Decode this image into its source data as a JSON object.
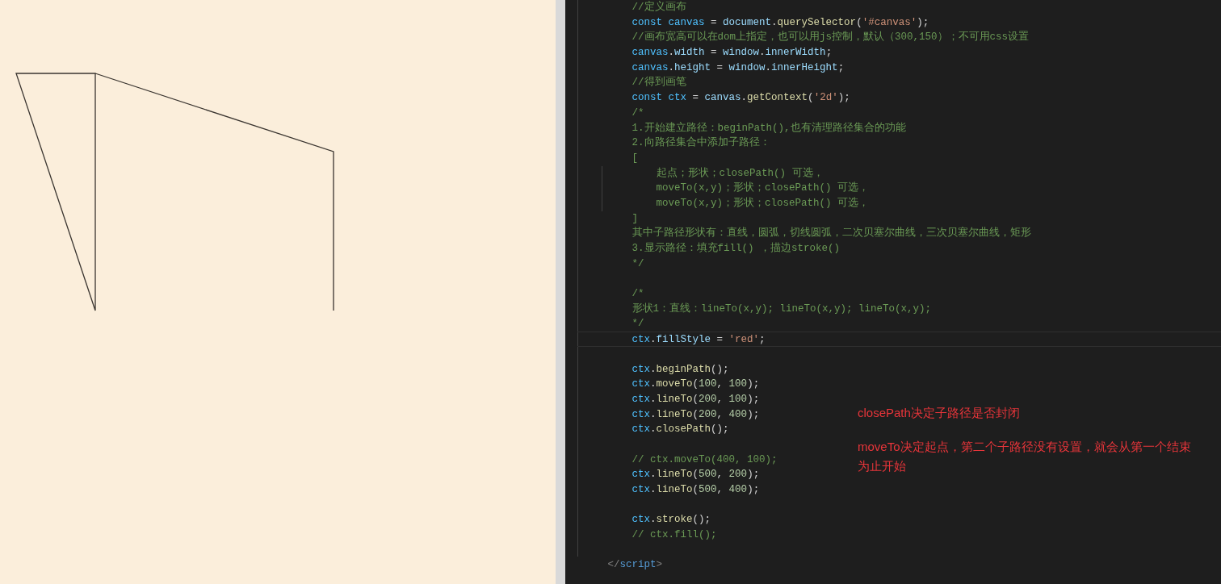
{
  "editor": {
    "lines": [
      {
        "kind": "code",
        "current_line": false,
        "tokens": [
          {
            "text": "//定义画布",
            "kind": "comment"
          }
        ]
      },
      {
        "kind": "code",
        "current_line": false,
        "tokens": [
          {
            "text": "const ",
            "kind": "keyword"
          },
          {
            "text": "canvas",
            "kind": "variable"
          },
          {
            "text": " = ",
            "kind": "punct"
          },
          {
            "text": "document",
            "kind": "property"
          },
          {
            "text": ".",
            "kind": "punct"
          },
          {
            "text": "querySelector",
            "kind": "function"
          },
          {
            "text": "(",
            "kind": "punct"
          },
          {
            "text": "'#canvas'",
            "kind": "string"
          },
          {
            "text": ");",
            "kind": "punct"
          }
        ]
      },
      {
        "kind": "code",
        "current_line": false,
        "tokens": [
          {
            "text": "//画布宽高可以在dom上指定，也可以用js控制，默认（300,150）；不可用css设置",
            "kind": "comment"
          }
        ]
      },
      {
        "kind": "code",
        "current_line": false,
        "tokens": [
          {
            "text": "canvas",
            "kind": "variable"
          },
          {
            "text": ".",
            "kind": "punct"
          },
          {
            "text": "width",
            "kind": "property"
          },
          {
            "text": " = ",
            "kind": "punct"
          },
          {
            "text": "window",
            "kind": "property"
          },
          {
            "text": ".",
            "kind": "punct"
          },
          {
            "text": "innerWidth",
            "kind": "property"
          },
          {
            "text": ";",
            "kind": "punct"
          }
        ]
      },
      {
        "kind": "code",
        "current_line": false,
        "tokens": [
          {
            "text": "canvas",
            "kind": "variable"
          },
          {
            "text": ".",
            "kind": "punct"
          },
          {
            "text": "height",
            "kind": "property"
          },
          {
            "text": " = ",
            "kind": "punct"
          },
          {
            "text": "window",
            "kind": "property"
          },
          {
            "text": ".",
            "kind": "punct"
          },
          {
            "text": "innerHeight",
            "kind": "property"
          },
          {
            "text": ";",
            "kind": "punct"
          }
        ]
      },
      {
        "kind": "code",
        "current_line": false,
        "tokens": [
          {
            "text": "//得到画笔",
            "kind": "comment"
          }
        ]
      },
      {
        "kind": "code",
        "current_line": false,
        "tokens": [
          {
            "text": "const ",
            "kind": "keyword"
          },
          {
            "text": "ctx",
            "kind": "variable"
          },
          {
            "text": " = ",
            "kind": "punct"
          },
          {
            "text": "canvas",
            "kind": "property"
          },
          {
            "text": ".",
            "kind": "punct"
          },
          {
            "text": "getContext",
            "kind": "function"
          },
          {
            "text": "(",
            "kind": "punct"
          },
          {
            "text": "'2d'",
            "kind": "string"
          },
          {
            "text": ");",
            "kind": "punct"
          }
        ]
      },
      {
        "kind": "code",
        "current_line": false,
        "tokens": [
          {
            "text": "/*",
            "kind": "comment"
          }
        ]
      },
      {
        "kind": "code",
        "current_line": false,
        "tokens": [
          {
            "text": "1.开始建立路径：beginPath(),也有清理路径集合的功能",
            "kind": "comment"
          }
        ]
      },
      {
        "kind": "code",
        "current_line": false,
        "tokens": [
          {
            "text": "2.向路径集合中添加子路径：",
            "kind": "comment"
          }
        ]
      },
      {
        "kind": "code",
        "current_line": false,
        "tokens": [
          {
            "text": "[",
            "kind": "comment"
          }
        ]
      },
      {
        "kind": "nested",
        "current_line": false,
        "tokens": [
          {
            "text": "起点；形状；closePath() 可选，",
            "kind": "comment"
          }
        ]
      },
      {
        "kind": "nested",
        "current_line": false,
        "tokens": [
          {
            "text": "moveTo(x,y)；形状；closePath() 可选，",
            "kind": "comment"
          }
        ]
      },
      {
        "kind": "nested",
        "current_line": false,
        "tokens": [
          {
            "text": "moveTo(x,y)；形状；closePath() 可选，",
            "kind": "comment"
          }
        ]
      },
      {
        "kind": "code",
        "current_line": false,
        "tokens": [
          {
            "text": "]",
            "kind": "comment"
          }
        ]
      },
      {
        "kind": "code",
        "current_line": false,
        "tokens": [
          {
            "text": "其中子路径形状有：直线，圆弧，切线圆弧，二次贝塞尔曲线，三次贝塞尔曲线，矩形",
            "kind": "comment"
          }
        ]
      },
      {
        "kind": "code",
        "current_line": false,
        "tokens": [
          {
            "text": "3.显示路径：填充fill() ，描边stroke()",
            "kind": "comment"
          }
        ]
      },
      {
        "kind": "code",
        "current_line": false,
        "tokens": [
          {
            "text": "*/",
            "kind": "comment"
          }
        ]
      },
      {
        "kind": "blank",
        "current_line": false
      },
      {
        "kind": "code",
        "current_line": false,
        "tokens": [
          {
            "text": "/*",
            "kind": "comment"
          }
        ]
      },
      {
        "kind": "code",
        "current_line": false,
        "tokens": [
          {
            "text": "形状1：直线：lineTo(x,y); lineTo(x,y); lineTo(x,y);",
            "kind": "comment"
          }
        ]
      },
      {
        "kind": "code",
        "current_line": false,
        "tokens": [
          {
            "text": "*/",
            "kind": "comment"
          }
        ]
      },
      {
        "kind": "code",
        "current_line": true,
        "tokens": [
          {
            "text": "ctx",
            "kind": "variable"
          },
          {
            "text": ".",
            "kind": "punct"
          },
          {
            "text": "fillStyle",
            "kind": "property"
          },
          {
            "text": " = ",
            "kind": "punct"
          },
          {
            "text": "'red'",
            "kind": "string"
          },
          {
            "text": ";",
            "kind": "punct"
          }
        ]
      },
      {
        "kind": "blank",
        "current_line": false
      },
      {
        "kind": "code",
        "current_line": false,
        "tokens": [
          {
            "text": "ctx",
            "kind": "variable"
          },
          {
            "text": ".",
            "kind": "punct"
          },
          {
            "text": "beginPath",
            "kind": "function"
          },
          {
            "text": "();",
            "kind": "punct"
          }
        ]
      },
      {
        "kind": "code",
        "current_line": false,
        "tokens": [
          {
            "text": "ctx",
            "kind": "variable"
          },
          {
            "text": ".",
            "kind": "punct"
          },
          {
            "text": "moveTo",
            "kind": "function"
          },
          {
            "text": "(",
            "kind": "punct"
          },
          {
            "text": "100",
            "kind": "number"
          },
          {
            "text": ", ",
            "kind": "punct"
          },
          {
            "text": "100",
            "kind": "number"
          },
          {
            "text": ");",
            "kind": "punct"
          }
        ]
      },
      {
        "kind": "code",
        "current_line": false,
        "tokens": [
          {
            "text": "ctx",
            "kind": "variable"
          },
          {
            "text": ".",
            "kind": "punct"
          },
          {
            "text": "lineTo",
            "kind": "function"
          },
          {
            "text": "(",
            "kind": "punct"
          },
          {
            "text": "200",
            "kind": "number"
          },
          {
            "text": ", ",
            "kind": "punct"
          },
          {
            "text": "100",
            "kind": "number"
          },
          {
            "text": ");",
            "kind": "punct"
          }
        ]
      },
      {
        "kind": "code",
        "current_line": false,
        "tokens": [
          {
            "text": "ctx",
            "kind": "variable"
          },
          {
            "text": ".",
            "kind": "punct"
          },
          {
            "text": "lineTo",
            "kind": "function"
          },
          {
            "text": "(",
            "kind": "punct"
          },
          {
            "text": "200",
            "kind": "number"
          },
          {
            "text": ", ",
            "kind": "punct"
          },
          {
            "text": "400",
            "kind": "number"
          },
          {
            "text": ");",
            "kind": "punct"
          }
        ]
      },
      {
        "kind": "code",
        "current_line": false,
        "tokens": [
          {
            "text": "ctx",
            "kind": "variable"
          },
          {
            "text": ".",
            "kind": "punct"
          },
          {
            "text": "closePath",
            "kind": "function"
          },
          {
            "text": "();",
            "kind": "punct"
          }
        ]
      },
      {
        "kind": "blank",
        "current_line": false
      },
      {
        "kind": "code",
        "current_line": false,
        "tokens": [
          {
            "text": "// ctx.moveTo(400, 100);",
            "kind": "comment"
          }
        ]
      },
      {
        "kind": "code",
        "current_line": false,
        "tokens": [
          {
            "text": "ctx",
            "kind": "variable"
          },
          {
            "text": ".",
            "kind": "punct"
          },
          {
            "text": "lineTo",
            "kind": "function"
          },
          {
            "text": "(",
            "kind": "punct"
          },
          {
            "text": "500",
            "kind": "number"
          },
          {
            "text": ", ",
            "kind": "punct"
          },
          {
            "text": "200",
            "kind": "number"
          },
          {
            "text": ");",
            "kind": "punct"
          }
        ]
      },
      {
        "kind": "code",
        "current_line": false,
        "tokens": [
          {
            "text": "ctx",
            "kind": "variable"
          },
          {
            "text": ".",
            "kind": "punct"
          },
          {
            "text": "lineTo",
            "kind": "function"
          },
          {
            "text": "(",
            "kind": "punct"
          },
          {
            "text": "500",
            "kind": "number"
          },
          {
            "text": ", ",
            "kind": "punct"
          },
          {
            "text": "400",
            "kind": "number"
          },
          {
            "text": ");",
            "kind": "punct"
          }
        ]
      },
      {
        "kind": "blank",
        "current_line": false
      },
      {
        "kind": "code",
        "current_line": false,
        "tokens": [
          {
            "text": "ctx",
            "kind": "variable"
          },
          {
            "text": ".",
            "kind": "punct"
          },
          {
            "text": "stroke",
            "kind": "function"
          },
          {
            "text": "();",
            "kind": "punct"
          }
        ]
      },
      {
        "kind": "code",
        "current_line": false,
        "tokens": [
          {
            "text": "// ctx.fill();",
            "kind": "comment"
          }
        ]
      },
      {
        "kind": "blank",
        "current_line": false
      },
      {
        "kind": "outer",
        "current_line": false,
        "tokens": [
          {
            "text": "</",
            "kind": "tag_punct"
          },
          {
            "text": "script",
            "kind": "tag"
          },
          {
            "text": ">",
            "kind": "tag_punct"
          }
        ]
      }
    ],
    "annotations": [
      "closePath决定子路径是否封闭",
      "moveTo决定起点，第二个子路径没有设置，就会从第一个结束为止开始"
    ]
  }
}
